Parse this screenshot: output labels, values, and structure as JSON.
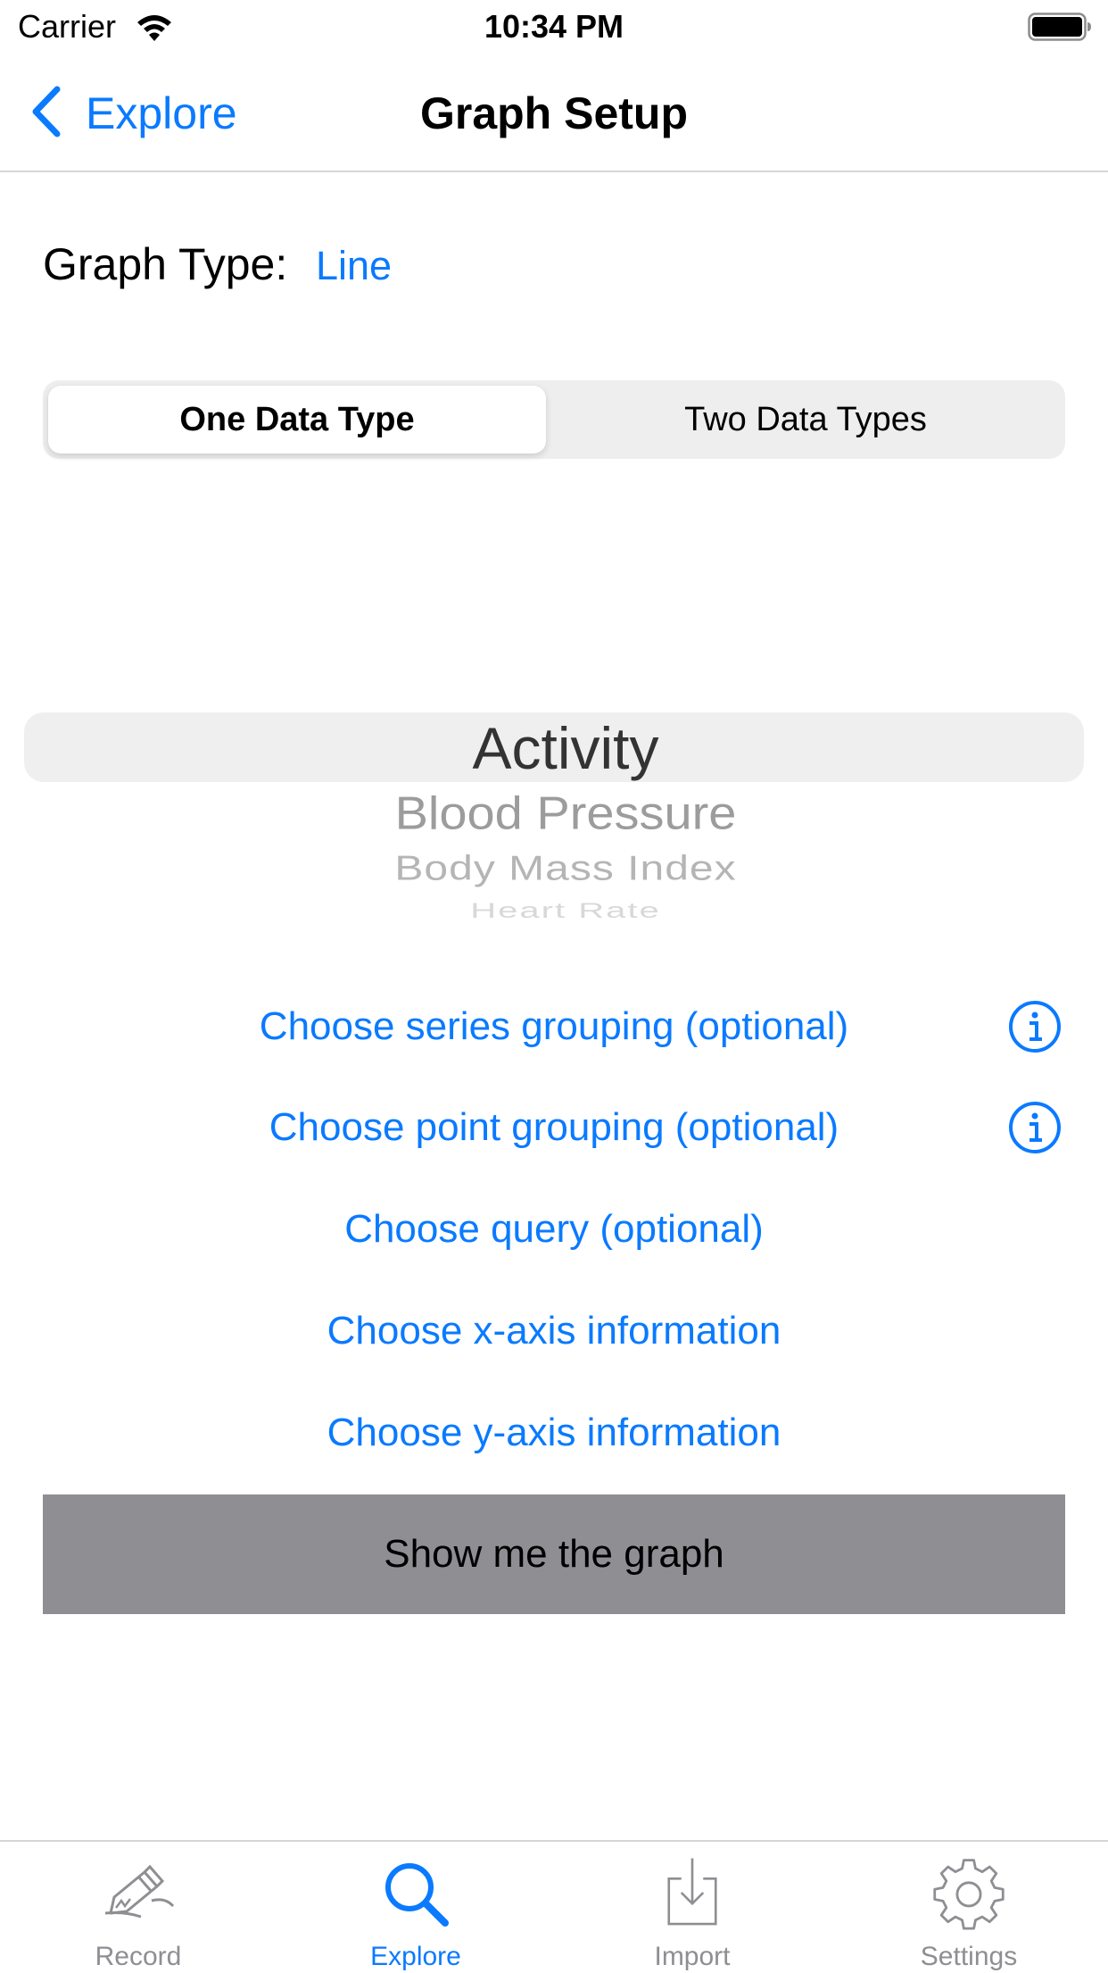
{
  "status_bar": {
    "carrier": "Carrier",
    "time": "10:34 PM",
    "icons": [
      "wifi-icon",
      "battery-icon"
    ]
  },
  "nav": {
    "back_label": "Explore",
    "title": "Graph Setup"
  },
  "graph_type": {
    "label": "Graph Type:",
    "value": "Line"
  },
  "segmented": {
    "options": [
      "One Data Type",
      "Two Data Types"
    ],
    "selected_index": 0
  },
  "picker": {
    "items": [
      "Activity",
      "Blood Pressure",
      "Body Mass Index",
      "Heart Rate"
    ],
    "selected": "Activity"
  },
  "options": {
    "series_grouping": "Choose series grouping (optional)",
    "point_grouping": "Choose point grouping (optional)",
    "query": "Choose query (optional)",
    "x_axis": "Choose x-axis information",
    "y_axis": "Choose y-axis information"
  },
  "show_graph_label": "Show me the graph",
  "tabbar": {
    "tabs": [
      {
        "label": "Record",
        "icon": "record-icon",
        "active": false
      },
      {
        "label": "Explore",
        "icon": "search-icon",
        "active": true
      },
      {
        "label": "Import",
        "icon": "import-icon",
        "active": false
      },
      {
        "label": "Settings",
        "icon": "gear-icon",
        "active": false
      }
    ]
  },
  "colors": {
    "accent": "#0a7aff",
    "inactive_tab": "#8e8e93",
    "button_bg": "#8e8e93",
    "segment_bg": "#eeeeef"
  }
}
